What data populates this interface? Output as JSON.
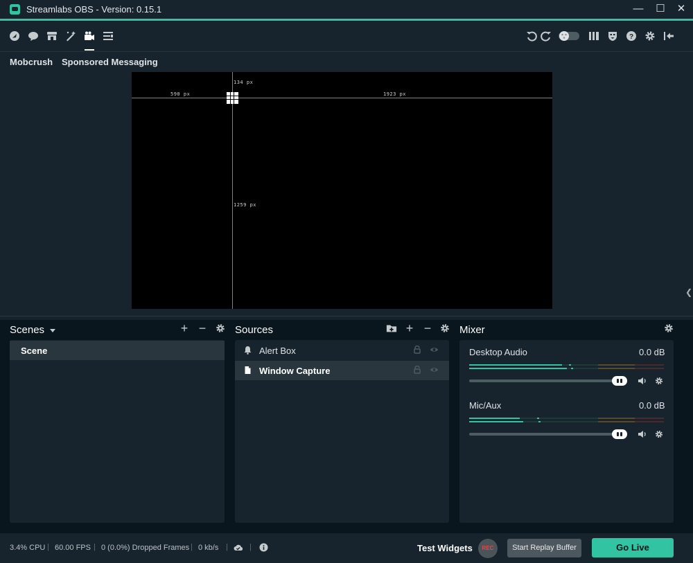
{
  "titlebar": {
    "title": "Streamlabs OBS - Version: 0.15.1",
    "minimize": "—",
    "maximize": "☐",
    "close": "✕"
  },
  "nav": {
    "left_icons": [
      "dashboard-icon",
      "chat-icon",
      "store-icon",
      "themes-icon",
      "editor-icon",
      "layout-icon"
    ],
    "active": "editor-icon",
    "right_icons": [
      "undo-icon",
      "redo-icon",
      "studio-mode-toggle-icon",
      "layout-columns-icon",
      "facemask-icon",
      "help-icon",
      "settings-icon",
      "logout-icon"
    ]
  },
  "subtabs": [
    "Mobcrush",
    "Sponsored Messaging"
  ],
  "canvas": {
    "label_top": "134 px",
    "label_left": "590 px",
    "label_right": "1923 px",
    "label_bottom": "1259 px"
  },
  "scenes": {
    "title": "Scenes",
    "items": [
      "Scene"
    ],
    "selected": "Scene"
  },
  "sources": {
    "title": "Sources",
    "items": [
      {
        "name": "Alert Box",
        "icon": "bell-icon",
        "selected": false
      },
      {
        "name": "Window Capture",
        "icon": "file-icon",
        "selected": true
      }
    ]
  },
  "mixer": {
    "title": "Mixer",
    "channels": [
      {
        "name": "Desktop Audio",
        "db": "0.0 dB",
        "volume": 1.0
      },
      {
        "name": "Mic/Aux",
        "db": "0.0 dB",
        "volume": 1.0
      }
    ]
  },
  "footer": {
    "cpu": "3.4% CPU",
    "fps": "60.00 FPS",
    "dropped": "0 (0.0%) Dropped Frames",
    "bandwidth": "0 kb/s",
    "separator": "|",
    "test_widgets": "Test Widgets",
    "rec": "REC",
    "replay": "Start Replay Buffer",
    "golive": "Go Live"
  },
  "colors": {
    "accent": "#31c3a2",
    "panel": "#17242d",
    "background": "#09161d"
  }
}
